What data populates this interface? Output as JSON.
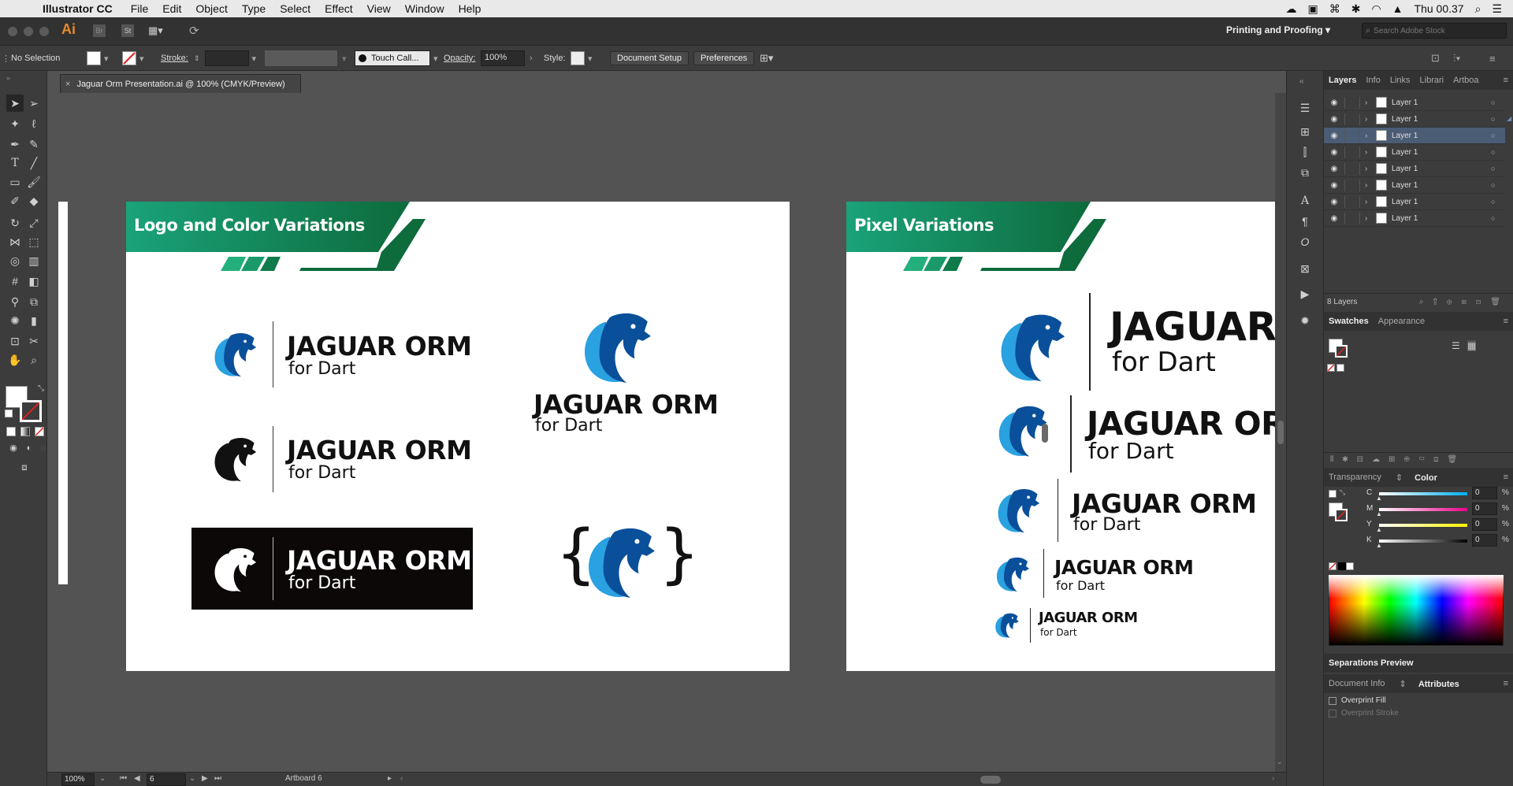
{
  "menubar": {
    "app_name": "Illustrator CC",
    "items": [
      "File",
      "Edit",
      "Object",
      "Type",
      "Select",
      "Effect",
      "View",
      "Window",
      "Help"
    ],
    "clock": "Thu 00.37"
  },
  "appbar": {
    "ai_label": "Ai",
    "br_label": "Br",
    "st_label": "St",
    "workspace": "Printing and Proofing",
    "search_placeholder": "Search Adobe Stock"
  },
  "controlbar": {
    "selection": "No Selection",
    "stroke_label": "Stroke:",
    "brush_name": "Touch Call...",
    "opacity_label": "Opacity:",
    "opacity_value": "100%",
    "style_label": "Style:",
    "document_setup": "Document Setup",
    "preferences": "Preferences"
  },
  "document": {
    "tab_title": "Jaguar Orm Presentation.ai @ 100% (CMYK/Preview)",
    "close_glyph": "×"
  },
  "artboard_left": {
    "banner_title": "Logo and Color Variations",
    "logos": [
      {
        "title": "JAGUAR ORM",
        "sub": "for Dart"
      },
      {
        "title": "JAGUAR ORM",
        "sub": "for Dart"
      },
      {
        "title": "JAGUAR ORM",
        "sub": "for Dart"
      },
      {
        "title": "JAGUAR ORM",
        "sub": "for Dart"
      }
    ],
    "brace_open": "{",
    "brace_close": "}"
  },
  "artboard_right": {
    "banner_title": "Pixel Variations",
    "logos": [
      {
        "title": "JAGUAR",
        "sub": "for Dart"
      },
      {
        "title": "JAGUAR ORM",
        "sub": "for Dart"
      },
      {
        "title": "JAGUAR ORM",
        "sub": "for Dart"
      },
      {
        "title": "JAGUAR ORM",
        "sub": "for Dart"
      },
      {
        "title": "JAGUAR ORM",
        "sub": "for Dart"
      }
    ]
  },
  "statusbar": {
    "zoom": "100%",
    "artboard_num": "6",
    "artboard_label": "Artboard 6"
  },
  "layers_panel": {
    "tabs": [
      "Layers",
      "Info",
      "Links",
      "Librari",
      "Artboa"
    ],
    "layers": [
      "Layer 1",
      "Layer 1",
      "Layer 1",
      "Layer 1",
      "Layer 1",
      "Layer 1",
      "Layer 1",
      "Layer 1"
    ],
    "count": "8 Layers"
  },
  "swatches_panel": {
    "tabs": [
      "Swatches",
      "Appearance"
    ]
  },
  "color_panel": {
    "tabs": [
      "Transparency",
      "Color"
    ],
    "channels": [
      {
        "name": "C",
        "value": "0",
        "unit": "%"
      },
      {
        "name": "M",
        "value": "0",
        "unit": "%"
      },
      {
        "name": "Y",
        "value": "0",
        "unit": "%"
      },
      {
        "name": "K",
        "value": "0",
        "unit": "%"
      }
    ]
  },
  "separations": {
    "title": "Separations Preview"
  },
  "attributes_panel": {
    "tabs": [
      "Document Info",
      "Attributes"
    ],
    "overprint_fill": "Overprint Fill",
    "overprint_stroke": "Overprint Stroke"
  },
  "colors": {
    "banner_light": "#1aa37a",
    "banner_dark": "#0d6b3c",
    "jaguar_dark": "#0a4f9a",
    "jaguar_light": "#2aa1e0",
    "selection": "#4b5d75"
  }
}
